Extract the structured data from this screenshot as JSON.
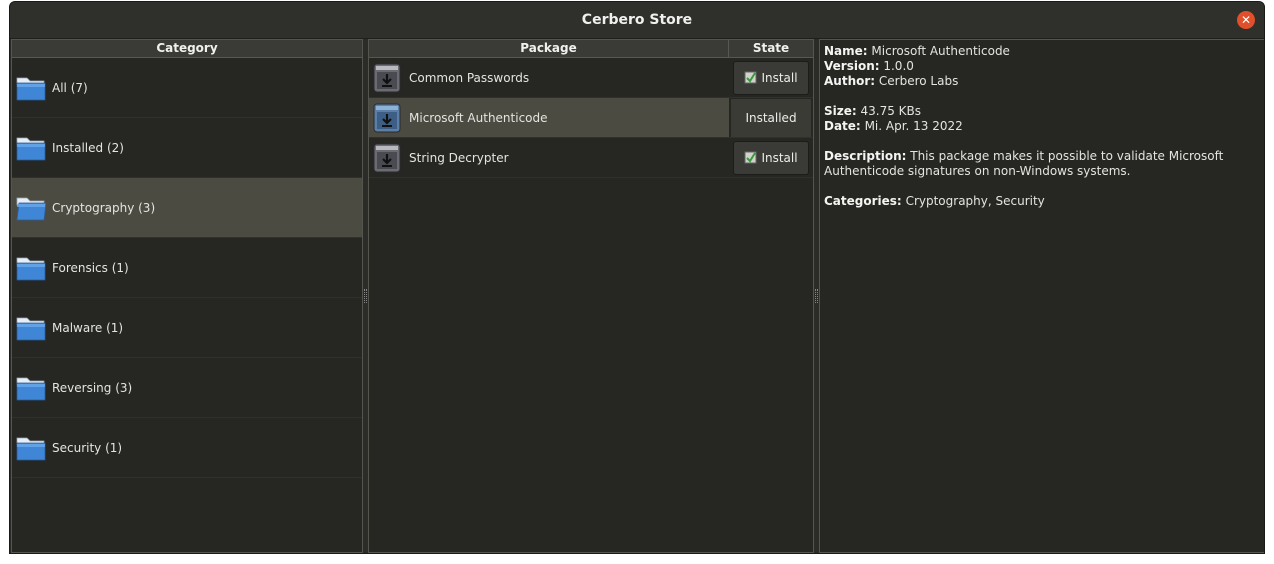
{
  "window": {
    "title": "Cerbero Store"
  },
  "categories": {
    "header": "Category",
    "items": [
      {
        "label": "All (7)"
      },
      {
        "label": "Installed (2)"
      },
      {
        "label": "Cryptography (3)"
      },
      {
        "label": "Forensics (1)"
      },
      {
        "label": "Malware (1)"
      },
      {
        "label": "Reversing (3)"
      },
      {
        "label": "Security (1)"
      }
    ],
    "selected_index": 2
  },
  "packages": {
    "header_package": "Package",
    "header_state": "State",
    "items": [
      {
        "name": "Common Passwords",
        "state": "Install"
      },
      {
        "name": "Microsoft Authenticode",
        "state": "Installed"
      },
      {
        "name": "String Decrypter",
        "state": "Install"
      }
    ],
    "selected_index": 1
  },
  "details": {
    "name_label": "Name:",
    "name": "Microsoft Authenticode",
    "version_label": "Version:",
    "version": "1.0.0",
    "author_label": "Author:",
    "author": "Cerbero Labs",
    "size_label": "Size:",
    "size": "43.75 KBs",
    "date_label": "Date:",
    "date": "Mi. Apr. 13 2022",
    "description_label": "Description:",
    "description_line1": "This package makes it possible to validate Microsoft",
    "description_line2": "Authenticode signatures on non-Windows systems.",
    "categories_label": "Categories:",
    "categories": "Cryptography, Security"
  },
  "colors": {
    "close": "#e0502a",
    "selection": "#4c4b42",
    "folder": "#3f86d6"
  }
}
